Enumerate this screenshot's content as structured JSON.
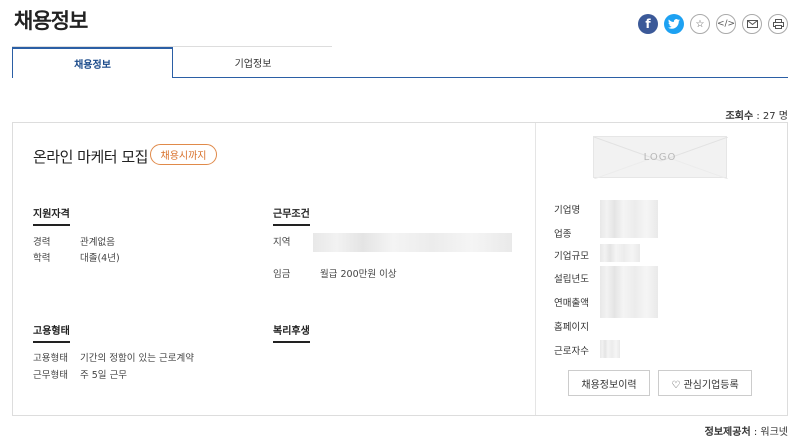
{
  "page": {
    "title": "채용정보"
  },
  "share_icons": [
    "facebook-icon",
    "twitter-icon",
    "star-icon",
    "code-icon",
    "mail-icon",
    "print-icon"
  ],
  "tabs": [
    {
      "label": "채용정보",
      "active": true
    },
    {
      "label": "기업정보",
      "active": false
    }
  ],
  "views": {
    "label": "조회수",
    "value": ": 27 명"
  },
  "job": {
    "title": "온라인 마케터 모집",
    "badge": "채용시까지",
    "qualifications": {
      "heading": "지원자격",
      "rows": [
        {
          "label": "경력",
          "value": "관계없음"
        },
        {
          "label": "학력",
          "value": "대졸(4년)"
        }
      ]
    },
    "conditions": {
      "heading": "근무조건",
      "rows": [
        {
          "label": "지역",
          "value": ""
        },
        {
          "label": "임금",
          "value": "월급 200만원 이상"
        }
      ]
    },
    "employment": {
      "heading": "고용형태",
      "rows": [
        {
          "label": "고용형태",
          "value": "기간의 정함이 있는 근로계약"
        },
        {
          "label": "근무형태",
          "value": "주 5일 근무"
        }
      ]
    },
    "welfare": {
      "heading": "복리후생"
    }
  },
  "company": {
    "logo_text": "LOGO",
    "fields": [
      "기업명",
      "업종",
      "기업규모",
      "설립년도",
      "연매출액",
      "홈페이지",
      "근로자수"
    ],
    "buttons": {
      "history": "채용정보이력",
      "favorite": "♡ 관심기업등록"
    }
  },
  "source": {
    "label": "정보제공처",
    "value": ": 워크넷"
  },
  "colors": {
    "accent": "#2b5fa5",
    "badge": "#d8702a",
    "facebook": "#3b5998",
    "twitter": "#1da1f2"
  }
}
